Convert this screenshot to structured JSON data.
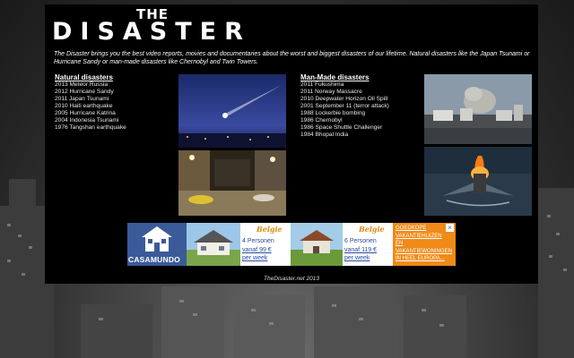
{
  "logo": {
    "line1": "THE",
    "line2": "DISASTER"
  },
  "intro": "The Disaster brings you the best video reports, movies and documentaries about the worst and biggest disasters of our lifetime. Natural disasters like the Japan Tsunami or Hurricane Sandy or man-made disasters like Chernobyl and Twin Towers.",
  "natural": {
    "title": "Natural disasters",
    "items": [
      "2013 Meteor Russia",
      "2012 Hurricane Sandy",
      "2011 Japan Tsunami",
      "2010 Haiti earthquake",
      "2005 Hurricane Katrina",
      "2004 Indonesia Tsunami",
      "1976 Tangshan earthquake"
    ]
  },
  "manmade": {
    "title": "Man-Made disasters",
    "items": [
      "2011 Fukushima",
      "2011 Norway Massacre",
      "2010 Deepwater Horizon Oil Spill",
      "2001 September 11 (terror attack)",
      "1988 Lockerbie bombing",
      "1986 Chernobyl",
      "1986 Space Shuttle Challenger",
      "1984 Bhopal India"
    ]
  },
  "ad": {
    "brand": "CASAMUNDO",
    "offer1": {
      "country": "Belgie",
      "persons": "4 Personen",
      "price": "vanaf 99 €",
      "period": "per week"
    },
    "offer2": {
      "country": "Belgie",
      "persons": "6 Personen",
      "price": "vanaf 119 €",
      "period": "per week"
    },
    "promo": "Goedkope Vakantiehuizen en Vakantiewoningen in heel Europa..."
  },
  "footer": "TheDisaster.net 2013"
}
